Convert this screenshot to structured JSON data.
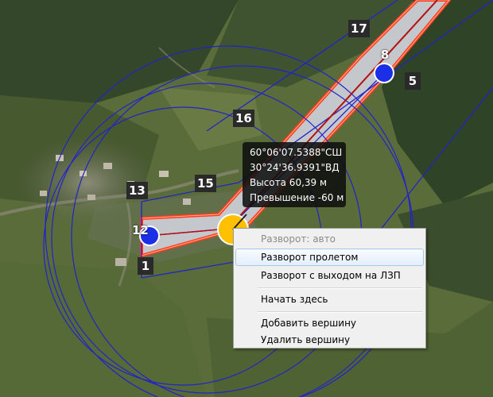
{
  "map": {
    "waypoint_labels": [
      "17",
      "8",
      "5",
      "16",
      "13",
      "15",
      "12",
      "1"
    ],
    "colors": {
      "route_line": "#2323c8",
      "corridor_fill": "#c4c8cc",
      "corridor_border": "#ff3b1a",
      "waypoint_blue": "#1a2fe6",
      "waypoint_selected": "#ffc000"
    }
  },
  "tooltip": {
    "lat": "60°06'07.5388\"СШ",
    "lon": "30°24'36.9391\"ВД",
    "altitude": "Высота 60,39 м",
    "elevation_diff": "Превышение -60 м"
  },
  "context_menu": {
    "items": [
      {
        "label": "Разворот: авто",
        "enabled": false
      },
      {
        "label": "Разворот пролетом",
        "enabled": true,
        "highlighted": true
      },
      {
        "label": "Разворот с выходом на ЛЗП",
        "enabled": true
      },
      {
        "label": "Начать здесь",
        "enabled": true
      },
      {
        "label": "Добавить вершину",
        "enabled": true
      },
      {
        "label": "Удалить вершину",
        "enabled": true
      }
    ]
  }
}
